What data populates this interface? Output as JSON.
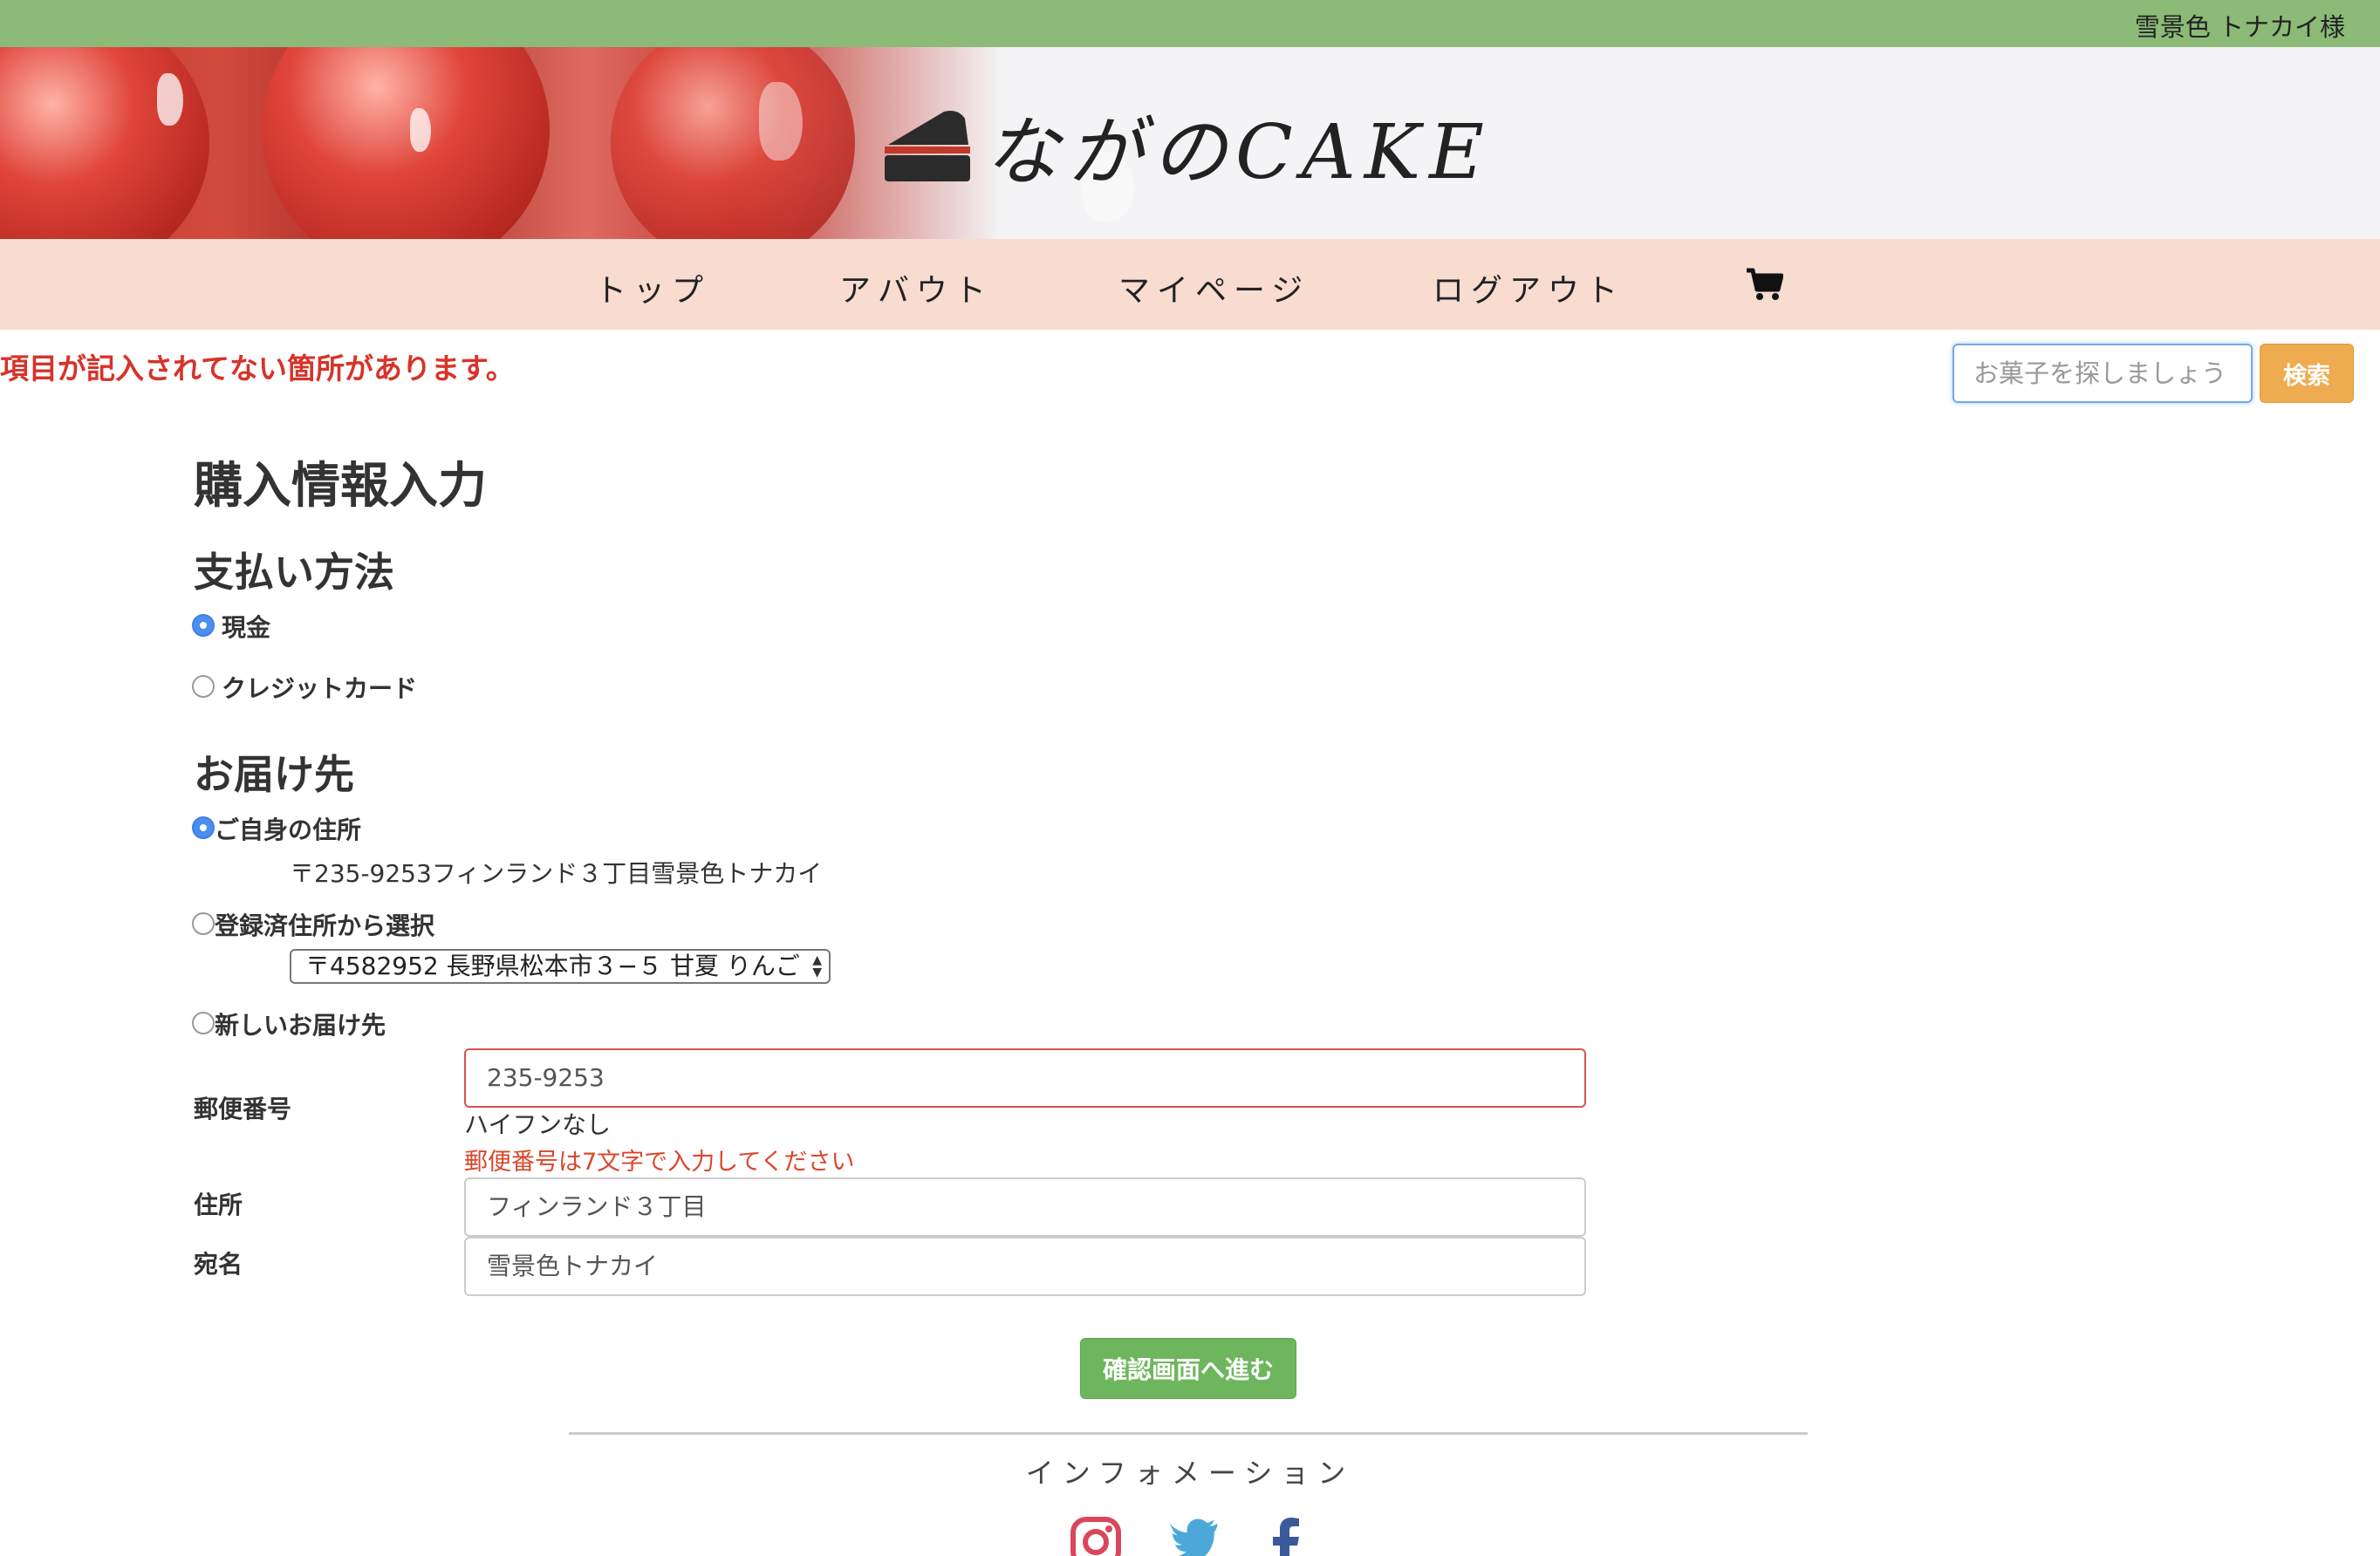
{
  "header": {
    "user_name": "雪景色 トナカイ様"
  },
  "brand": {
    "logo_text": "ながのCAKE"
  },
  "nav": {
    "items": [
      {
        "label": "トップ"
      },
      {
        "label": "アバウト"
      },
      {
        "label": "マイページ"
      },
      {
        "label": "ログアウト"
      }
    ],
    "cart_icon": "shopping-cart-icon"
  },
  "alert": {
    "message": "項目が記入されてない箇所があります。"
  },
  "search": {
    "placeholder": "お菓子を探しましょう",
    "button_label": "検索"
  },
  "page": {
    "title": "購入情報入力"
  },
  "payment": {
    "heading": "支払い方法",
    "options": [
      {
        "label": "現金",
        "checked": true
      },
      {
        "label": "クレジットカード",
        "checked": false
      }
    ]
  },
  "delivery": {
    "heading": "お届け先",
    "own_address": {
      "label": "ご自身の住所",
      "checked": true,
      "address": "〒235-9253フィンランド３丁目雪景色トナカイ"
    },
    "registered": {
      "label": "登録済住所から選択",
      "checked": false,
      "selected_option": "〒4582952 長野県松本市３−５ 甘夏 りんご"
    },
    "new_address": {
      "label": "新しいお届け先",
      "checked": false,
      "postal_label": "郵便番号",
      "postal_value": "235-9253",
      "postal_hint": "ハイフンなし",
      "postal_error": "郵便番号は7文字で入力してください",
      "address_label": "住所",
      "address_value": "フィンランド３丁目",
      "name_label": "宛名",
      "name_value": "雪景色トナカイ"
    }
  },
  "submit": {
    "label": "確認画面へ進む"
  },
  "footer": {
    "info_label": "インフォメーション",
    "social_icons": [
      "instagram-icon",
      "twitter-icon",
      "facebook-icon"
    ]
  },
  "colors": {
    "topbar": "#8bbb77",
    "nav_bg": "#f8dcd0",
    "alert": "#d7332a",
    "search_button": "#eeab4f",
    "submit_button": "#6eb65d",
    "radio_checked": "#4b8ef0"
  }
}
